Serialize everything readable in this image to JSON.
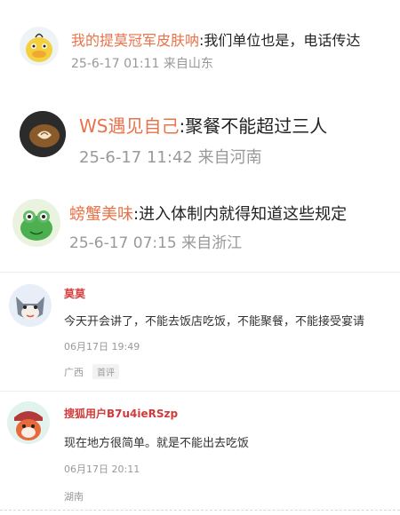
{
  "comments_top": [
    {
      "nickname": "我的提莫冠军皮肤呐",
      "text": ":我们单位也是，电话传达",
      "date": "25-6-17 01:11",
      "location": "来自山东",
      "avatar": "yellow-duck-avatar"
    },
    {
      "nickname": "WS遇见自己",
      "text": ":聚餐不能超过三人",
      "date": "25-6-17 11:42",
      "location": "来自河南",
      "avatar": "latte-coffee-avatar"
    },
    {
      "nickname": "螃蟹美味",
      "text": ":进入体制内就得知道这些规定",
      "date": "25-6-17 07:15",
      "location": "来自浙江",
      "avatar": "green-frog-avatar"
    }
  ],
  "comments_bottom": [
    {
      "nickname": "莫莫",
      "text": "今天开会讲了，不能去饭店吃饭，不能聚餐，不能接受宴请",
      "time": "06月17日 19:49",
      "region": "广西",
      "badge": "首评",
      "avatar": "gray-fox-avatar"
    },
    {
      "nickname": "搜狐用户B7u4ieRSzp",
      "text": "现在地方很简单。就是不能出去吃饭",
      "time": "06月17日 20:11",
      "region": "湖南",
      "avatar": "red-fox-avatar"
    }
  ],
  "colors": {
    "nickname_orange": "#e8734a",
    "nickname_red": "#d33a3a",
    "meta_gray": "#999999"
  }
}
